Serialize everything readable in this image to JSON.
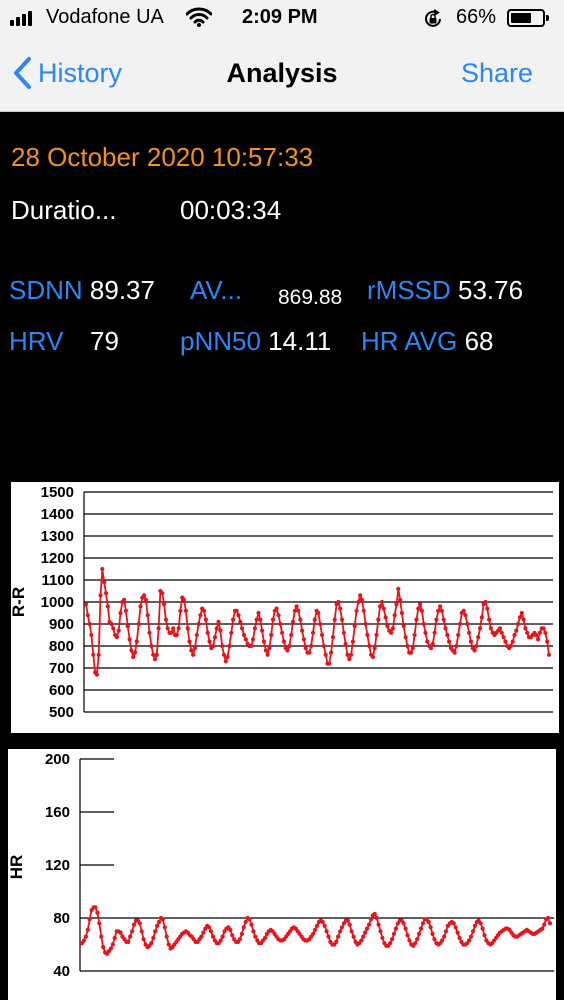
{
  "status_bar": {
    "carrier": "Vodafone UA",
    "time": "2:09 PM",
    "battery_percent": "66%",
    "battery_level": 0.66,
    "signal_bars": 4,
    "icons": [
      "signal-icon",
      "wifi-icon",
      "orientation-lock-icon",
      "battery-icon"
    ]
  },
  "nav": {
    "back_label": "History",
    "title": "Analysis",
    "share_label": "Share",
    "accent_color": "#2c86f3"
  },
  "session": {
    "datetime": "28 October 2020 10:57:33",
    "duration_label": "Duratio...",
    "duration_value": "00:03:34",
    "datetime_color": "#f29120"
  },
  "metrics": {
    "sdnn": {
      "label": "SDNN",
      "value": "89.37"
    },
    "avg": {
      "label": "AV...",
      "value": "869.88"
    },
    "rmssd": {
      "label": "rMSSD",
      "value": "53.76"
    },
    "hrv": {
      "label": "HRV",
      "value": "79"
    },
    "pnn50": {
      "label": "pNN50",
      "value": "14.11"
    },
    "hr_avg": {
      "label": "HR AVG",
      "value": "68"
    }
  },
  "chart_data": [
    {
      "type": "line",
      "ylabel": "R-R",
      "ylim": [
        500,
        1500
      ],
      "yticks": [
        1500,
        1400,
        1300,
        1200,
        1100,
        1000,
        900,
        800,
        700,
        600,
        500
      ],
      "grid": "horizontal",
      "color": "#e8141c",
      "series": [
        {
          "values": [
            990,
            940,
            900,
            850,
            760,
            680,
            670,
            760,
            1030,
            1150,
            1090,
            1040,
            980,
            910,
            900,
            880,
            850,
            840,
            870,
            950,
            1000,
            1010,
            960,
            890,
            830,
            780,
            750,
            770,
            820,
            900,
            980,
            1020,
            1030,
            1010,
            940,
            860,
            800,
            760,
            740,
            760,
            880,
            1050,
            1040,
            990,
            920,
            880,
            860,
            860,
            880,
            850,
            850,
            880,
            960,
            1020,
            1010,
            960,
            880,
            820,
            780,
            760,
            790,
            850,
            900,
            940,
            970,
            960,
            920,
            860,
            820,
            790,
            800,
            840,
            880,
            910,
            870,
            800,
            760,
            730,
            750,
            800,
            860,
            920,
            960,
            960,
            940,
            910,
            880,
            850,
            830,
            810,
            800,
            800,
            830,
            880,
            920,
            950,
            920,
            870,
            820,
            780,
            760,
            790,
            850,
            920,
            960,
            970,
            940,
            900,
            860,
            820,
            790,
            780,
            800,
            850,
            910,
            960,
            980,
            960,
            920,
            870,
            830,
            790,
            770,
            770,
            800,
            860,
            920,
            960,
            950,
            900,
            850,
            800,
            760,
            720,
            720,
            770,
            840,
            920,
            990,
            1000,
            970,
            920,
            860,
            810,
            760,
            740,
            760,
            820,
            890,
            960,
            1000,
            1030,
            1010,
            960,
            900,
            850,
            800,
            760,
            750,
            790,
            850,
            920,
            980,
            1000,
            970,
            930,
            890,
            870,
            860,
            880,
            940,
            990,
            1060,
            1010,
            950,
            890,
            840,
            800,
            770,
            770,
            790,
            850,
            920,
            970,
            990,
            960,
            900,
            860,
            820,
            800,
            790,
            810,
            860,
            920,
            960,
            980,
            960,
            920,
            880,
            850,
            820,
            790,
            780,
            770,
            800,
            850,
            900,
            950,
            960,
            940,
            900,
            860,
            820,
            790,
            780,
            800,
            840,
            880,
            930,
            990,
            1000,
            970,
            920,
            880,
            860,
            850,
            860,
            870,
            880,
            860,
            840,
            820,
            800,
            790,
            800,
            820,
            850,
            870,
            900,
            930,
            950,
            920,
            880,
            860,
            840,
            840,
            850,
            860,
            850,
            830,
            860,
            880,
            880,
            860,
            820,
            760
          ]
        }
      ]
    },
    {
      "type": "line",
      "ylabel": "HR",
      "ylim": [
        40,
        200
      ],
      "yticks": [
        200,
        160,
        120,
        80,
        40
      ],
      "grid": "horizontal",
      "color": "#e8141c",
      "series": [
        {
          "values": [
            61,
            63,
            66,
            71,
            79,
            86,
            88,
            88,
            84,
            76,
            66,
            58,
            54,
            53,
            55,
            57,
            60,
            65,
            70,
            70,
            69,
            66,
            64,
            62,
            62,
            66,
            70,
            75,
            78,
            78,
            76,
            70,
            64,
            60,
            58,
            59,
            61,
            65,
            70,
            74,
            77,
            80,
            79,
            73,
            66,
            60,
            57,
            58,
            60,
            62,
            64,
            66,
            68,
            69,
            70,
            69,
            67,
            66,
            64,
            62,
            62,
            64,
            66,
            69,
            72,
            74,
            73,
            70,
            66,
            63,
            61,
            61,
            63,
            66,
            70,
            72,
            73,
            71,
            67,
            64,
            62,
            62,
            64,
            68,
            73,
            77,
            80,
            79,
            75,
            70,
            66,
            63,
            61,
            61,
            63,
            65,
            68,
            70,
            71,
            70,
            68,
            66,
            64,
            63,
            63,
            64,
            66,
            68,
            70,
            72,
            73,
            72,
            70,
            68,
            66,
            64,
            63,
            63,
            64,
            66,
            68,
            71,
            74,
            77,
            78,
            77,
            74,
            70,
            66,
            62,
            60,
            60,
            62,
            66,
            70,
            73,
            76,
            78,
            78,
            75,
            70,
            66,
            62,
            60,
            61,
            63,
            66,
            69,
            72,
            75,
            79,
            82,
            83,
            80,
            75,
            70,
            65,
            61,
            59,
            59,
            61,
            64,
            68,
            72,
            76,
            78,
            78,
            76,
            72,
            67,
            63,
            60,
            59,
            61,
            64,
            68,
            72,
            76,
            79,
            79,
            77,
            73,
            68,
            64,
            61,
            60,
            61,
            63,
            66,
            70,
            74,
            76,
            77,
            76,
            73,
            69,
            65,
            62,
            60,
            60,
            61,
            63,
            66,
            70,
            74,
            77,
            78,
            76,
            72,
            67,
            63,
            61,
            60,
            61,
            63,
            65,
            67,
            69,
            70,
            71,
            72,
            72,
            71,
            69,
            67,
            66,
            66,
            67,
            68,
            69,
            70,
            71,
            70,
            69,
            68,
            68,
            69,
            70,
            71,
            72,
            75,
            79,
            80,
            76
          ]
        }
      ]
    }
  ]
}
